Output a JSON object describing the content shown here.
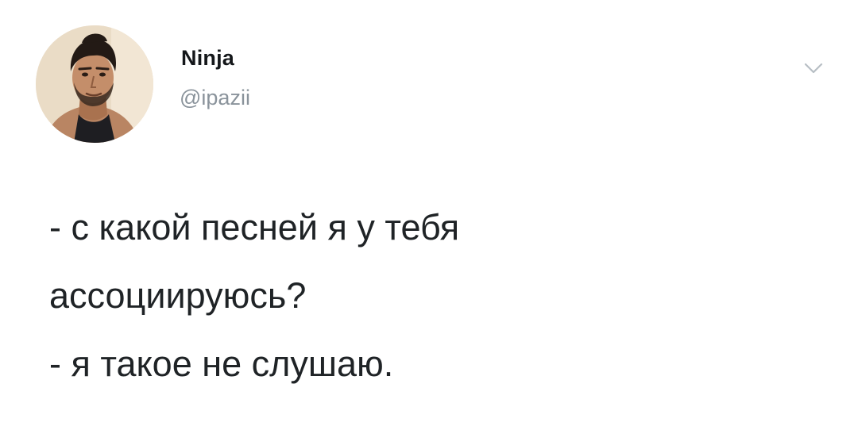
{
  "tweet": {
    "author": {
      "name": "Ninja",
      "handle": "@ipazii",
      "avatar_icon": "user-avatar-photo"
    },
    "menu_icon": "chevron-down-icon",
    "text_lines": [
      "- с какой песней я у тебя",
      "ассоциируюсь?",
      "- я такое не слушаю."
    ]
  },
  "colors": {
    "background": "#ffffff",
    "name": "#14171a",
    "handle": "#8a939b",
    "text": "#1f2326",
    "chevron": "#b7bec4"
  }
}
